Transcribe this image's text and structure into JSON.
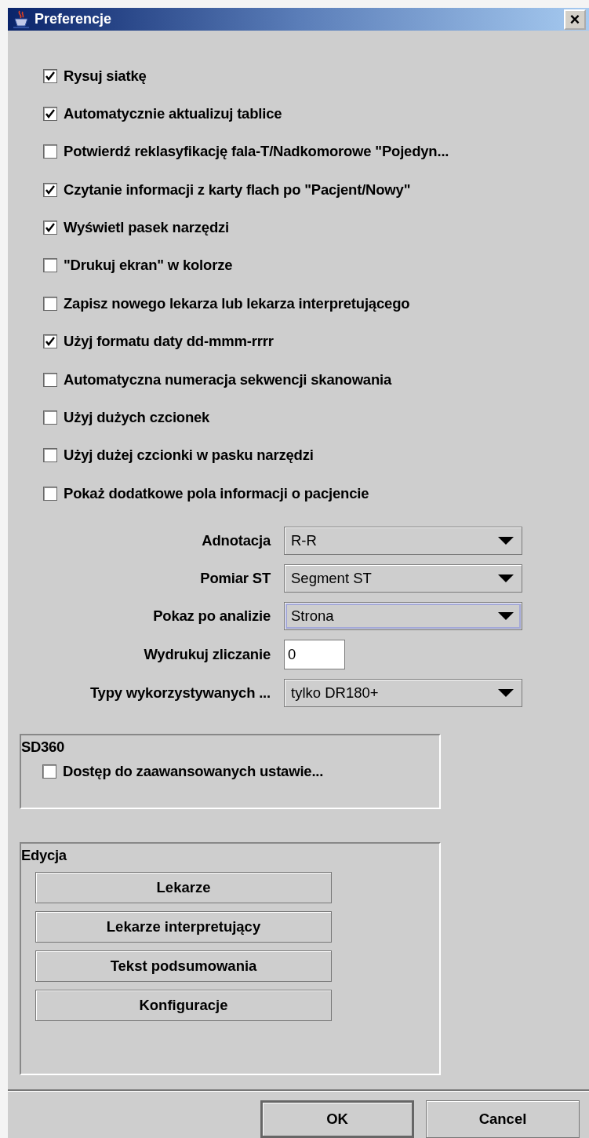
{
  "window": {
    "title": "Preferencje",
    "close": "×"
  },
  "options": [
    {
      "label": "Rysuj siatkę",
      "checked": true
    },
    {
      "label": "Automatycznie aktualizuj tablice",
      "checked": true
    },
    {
      "label": "Potwierdź reklasyfikację fala-T/Nadkomorowe \"Pojedyn...",
      "checked": false
    },
    {
      "label": "Czytanie informacji z karty flach po \"Pacjent/Nowy\"",
      "checked": true
    },
    {
      "label": "Wyświetl pasek narzędzi",
      "checked": true
    },
    {
      "label": "\"Drukuj ekran\" w kolorze",
      "checked": false
    },
    {
      "label": "Zapisz nowego lekarza lub lekarza interpretującego",
      "checked": false
    },
    {
      "label": "Użyj formatu daty dd-mmm-rrrr",
      "checked": true
    },
    {
      "label": "Automatyczna numeracja sekwencji skanowania",
      "checked": false
    },
    {
      "label": "Użyj dużych czcionek",
      "checked": false
    },
    {
      "label": "Użyj dużej czcionki w pasku narzędzi",
      "checked": false
    },
    {
      "label": "Pokaż dodatkowe pola informacji o pacjencie",
      "checked": false
    }
  ],
  "settings": [
    {
      "kind": "dropdown",
      "label": "Adnotacja",
      "value": "R-R",
      "focused": false
    },
    {
      "kind": "dropdown",
      "label": "Pomiar ST",
      "value": "Segment ST",
      "focused": false
    },
    {
      "kind": "dropdown",
      "label": "Pokaz po analizie",
      "value": "Strona",
      "focused": true
    },
    {
      "kind": "text",
      "label": "Wydrukuj zliczanie",
      "value": "0",
      "focused": false
    },
    {
      "kind": "dropdown",
      "label": "Typy wykorzystywanych ...",
      "value": "tylko DR180+",
      "focused": false
    }
  ],
  "sd360": {
    "title": "SD360",
    "options": [
      {
        "label": "Dostęp do zaawansowanych ustawie...",
        "checked": false
      }
    ]
  },
  "edit": {
    "title": "Edycja",
    "buttons": [
      "Lekarze",
      "Lekarze interpretujący",
      "Tekst podsumowania",
      "Konfiguracje"
    ]
  },
  "footer": [
    {
      "label": "OK",
      "default": true
    },
    {
      "label": "Cancel",
      "default": false
    }
  ]
}
